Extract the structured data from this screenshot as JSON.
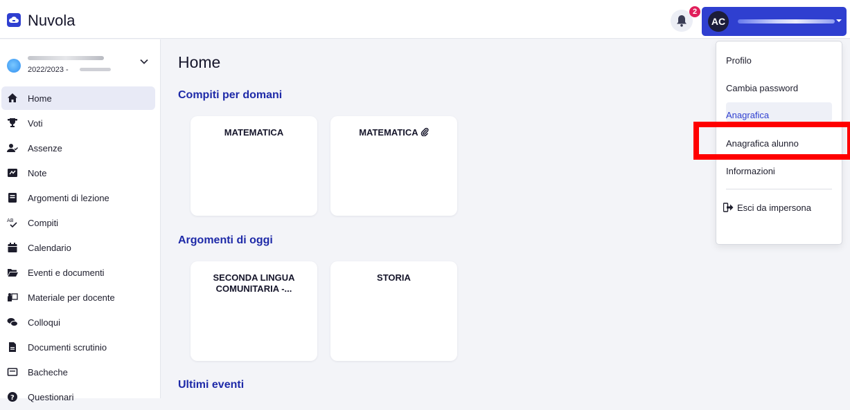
{
  "header": {
    "app_title": "Nuvola",
    "notifications_count": "2",
    "user_initials": "AC"
  },
  "sidebar": {
    "school_year": "2022/2023 -",
    "items": [
      {
        "label": "Home",
        "icon": "home-icon",
        "active": true
      },
      {
        "label": "Voti",
        "icon": "trophy-icon"
      },
      {
        "label": "Assenze",
        "icon": "user-check-icon"
      },
      {
        "label": "Note",
        "icon": "note-icon"
      },
      {
        "label": "Argomenti di lezione",
        "icon": "book-icon"
      },
      {
        "label": "Compiti",
        "icon": "spellcheck-icon"
      },
      {
        "label": "Calendario",
        "icon": "calendar-icon"
      },
      {
        "label": "Eventi e documenti",
        "icon": "folder-icon"
      },
      {
        "label": "Materiale per docente",
        "icon": "chalkboard-icon"
      },
      {
        "label": "Colloqui",
        "icon": "comments-icon"
      },
      {
        "label": "Documenti scrutinio",
        "icon": "file-icon"
      },
      {
        "label": "Bacheche",
        "icon": "board-icon"
      },
      {
        "label": "Questionari",
        "icon": "question-icon"
      }
    ]
  },
  "main": {
    "page_title": "Home",
    "sections": [
      {
        "title": "Compiti per domani",
        "cards": [
          {
            "title": "MATEMATICA"
          },
          {
            "title": "MATEMATICA"
          }
        ]
      },
      {
        "title": "Argomenti di oggi",
        "cards": [
          {
            "title": "SECONDA LINGUA COMUNITARIA -..."
          },
          {
            "title": "STORIA"
          }
        ]
      },
      {
        "title": "Ultimi eventi",
        "cards": []
      }
    ]
  },
  "user_menu": {
    "items": [
      "Profilo",
      "Cambia password",
      "Anagrafica",
      "Anagrafica alunno",
      "Informazioni"
    ],
    "exit_label": "Esci da impersona"
  },
  "colors": {
    "accent": "#2f3fd0",
    "section_title": "#1e2aa8",
    "badge": "#e01e5a",
    "highlight_box": "#ff0000"
  }
}
